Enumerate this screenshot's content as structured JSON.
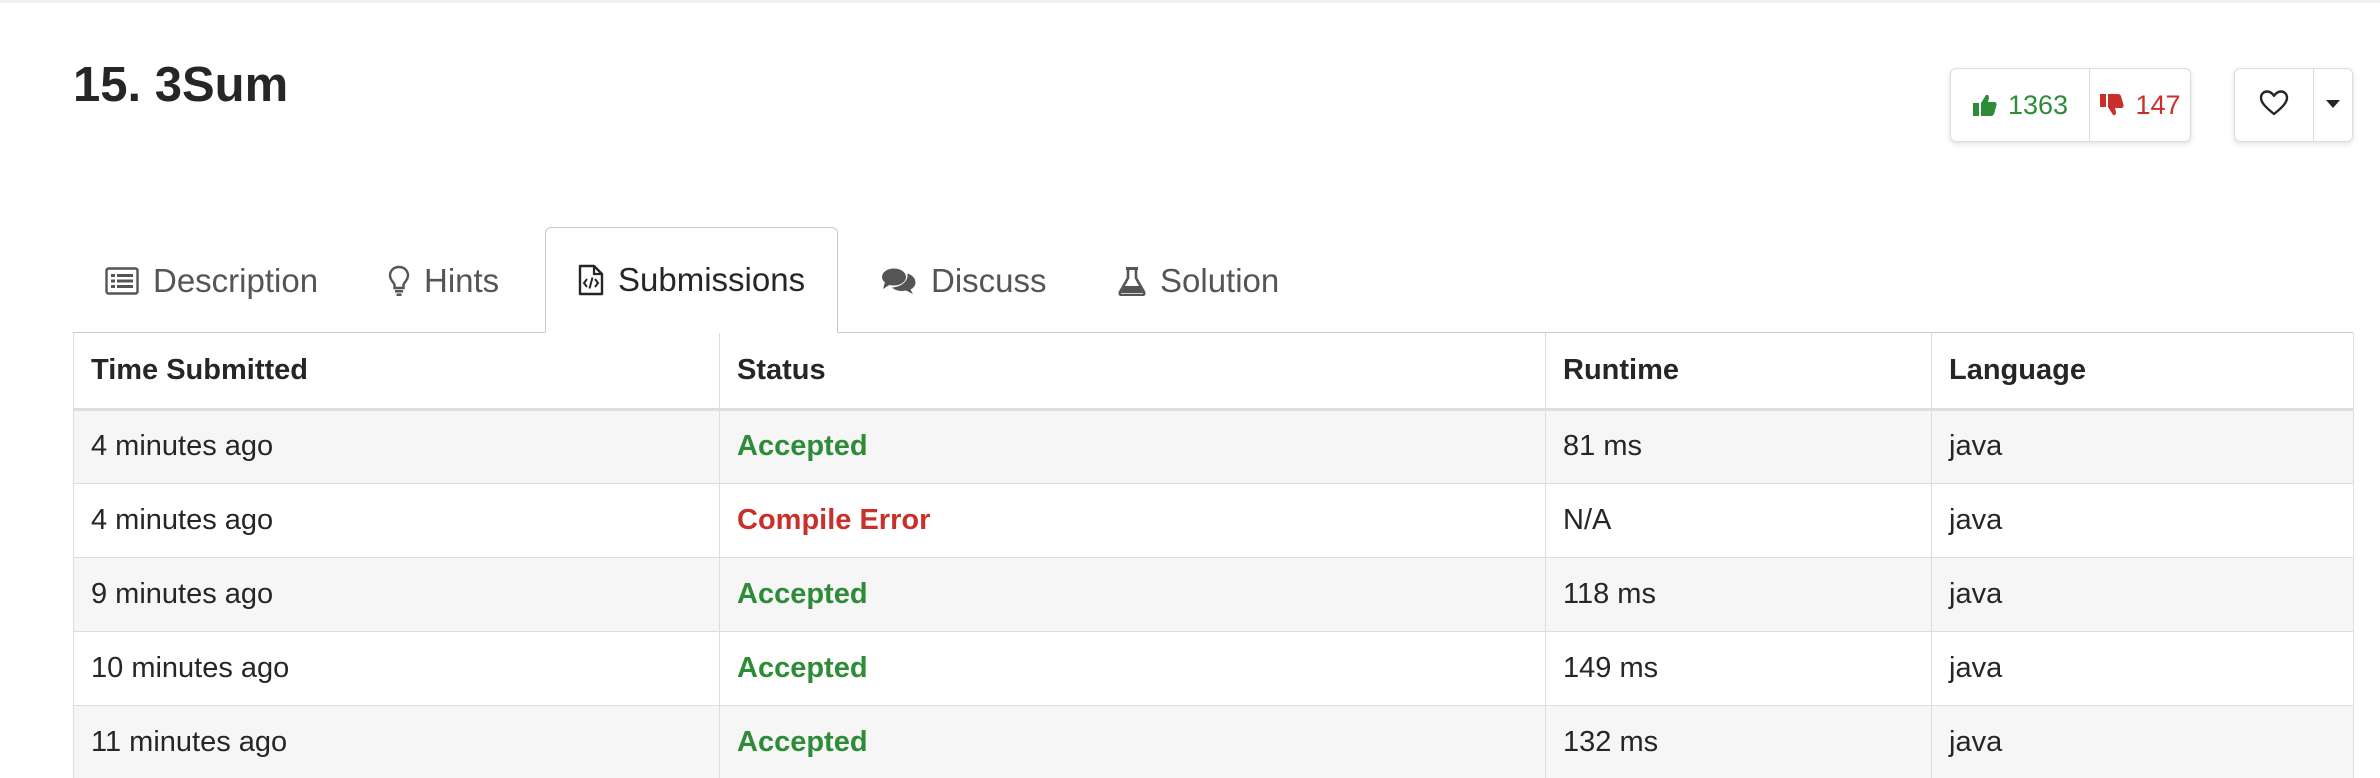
{
  "problem": {
    "title": "15. 3Sum"
  },
  "votes": {
    "likes": "1363",
    "dislikes": "147"
  },
  "tabs": [
    {
      "label": "Description",
      "icon": "list-icon"
    },
    {
      "label": "Hints",
      "icon": "lightbulb-icon"
    },
    {
      "label": "Submissions",
      "icon": "code-file-icon",
      "active": true
    },
    {
      "label": "Discuss",
      "icon": "comments-icon"
    },
    {
      "label": "Solution",
      "icon": "flask-icon"
    }
  ],
  "table": {
    "headers": [
      "Time Submitted",
      "Status",
      "Runtime",
      "Language"
    ],
    "rows": [
      {
        "time": "4 minutes ago",
        "status": "Accepted",
        "runtime": "81 ms",
        "language": "java"
      },
      {
        "time": "4 minutes ago",
        "status": "Compile Error",
        "runtime": "N/A",
        "language": "java"
      },
      {
        "time": "9 minutes ago",
        "status": "Accepted",
        "runtime": "118 ms",
        "language": "java"
      },
      {
        "time": "10 minutes ago",
        "status": "Accepted",
        "runtime": "149 ms",
        "language": "java"
      },
      {
        "time": "11 minutes ago",
        "status": "Accepted",
        "runtime": "132 ms",
        "language": "java"
      }
    ]
  },
  "colors": {
    "accepted": "#2e8b37",
    "error": "#c9302c"
  }
}
